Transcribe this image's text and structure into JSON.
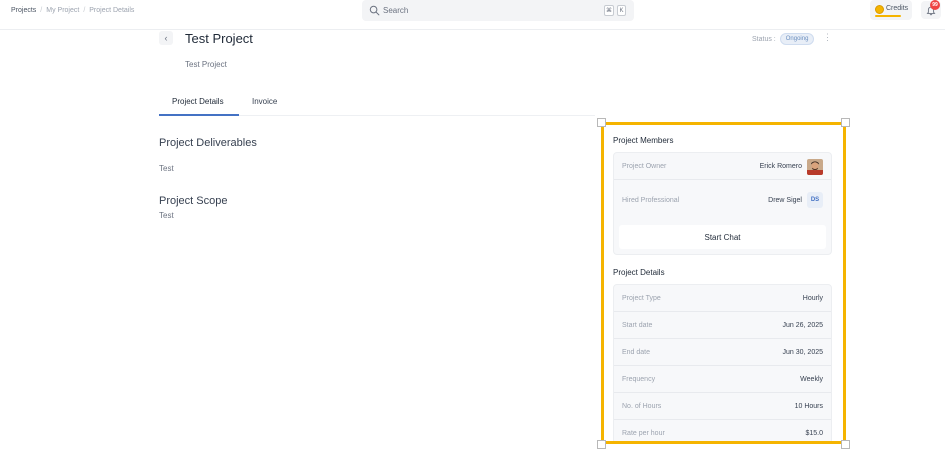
{
  "breadcrumb": [
    "Projects",
    "My Project",
    "Project Details"
  ],
  "search": {
    "placeholder": "Search",
    "shortcut_keys": [
      "⌘",
      "K"
    ]
  },
  "credits": {
    "label": "Credits"
  },
  "notifications": {
    "badge": "99"
  },
  "project": {
    "title": "Test Project",
    "subtitle": "Test Project",
    "status_label": "Status :",
    "status": "Ongoing"
  },
  "tabs": [
    {
      "label": "Project Details",
      "active": true
    },
    {
      "label": "Invoice",
      "active": false
    }
  ],
  "sections": [
    {
      "title": "Project Deliverables",
      "text": "Test"
    },
    {
      "title": "Project Scope",
      "text": "Test"
    }
  ],
  "members": {
    "heading": "Project Members",
    "owner": {
      "label": "Project Owner",
      "name": "Erick Romero"
    },
    "hired": {
      "label": "Hired Professional",
      "name": "Drew Sigel",
      "initials": "DS"
    },
    "chat_button": "Start Chat"
  },
  "details": {
    "heading": "Project Details",
    "rows": [
      {
        "label": "Project Type",
        "value": "Hourly"
      },
      {
        "label": "Start date",
        "value": "Jun 26, 2025"
      },
      {
        "label": "End date",
        "value": "Jun 30, 2025"
      },
      {
        "label": "Frequency",
        "value": "Weekly"
      },
      {
        "label": "No. of Hours",
        "value": "10 Hours"
      },
      {
        "label": "Rate per hour",
        "value": "$15.0"
      }
    ]
  },
  "colors": {
    "accent": "#4472c4",
    "highlight": "#f5b400",
    "badge": "#ef4444"
  }
}
